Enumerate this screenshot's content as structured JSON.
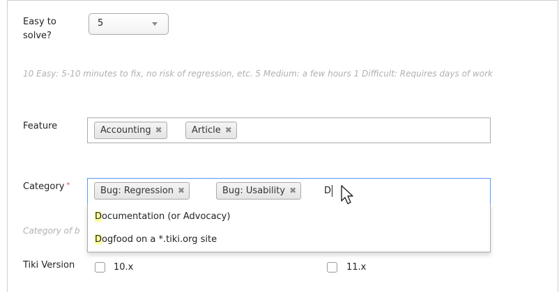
{
  "easy_to_solve": {
    "label": "Easy to solve?",
    "selected_value": "5",
    "help_text": "10 Easy: 5-10 minutes to fix, no risk of regression, etc. 5 Medium: a few hours 1 Difficult: Requires days of work"
  },
  "feature": {
    "label": "Feature",
    "tags": [
      {
        "label": "Accounting"
      },
      {
        "label": "Article"
      }
    ]
  },
  "category": {
    "label": "Category",
    "required_marker": "*",
    "tags": [
      {
        "label": "Bug: Regression"
      },
      {
        "label": "Bug: Usability"
      }
    ],
    "typed_text": "D",
    "help_text_partial": "Category of b",
    "suggestions": [
      {
        "match": "D",
        "rest": "ocumentation (or Advocacy)"
      },
      {
        "match": "D",
        "rest": "ogfood on a *.tiki.org site"
      }
    ]
  },
  "tiki_version": {
    "label": "Tiki Version",
    "options": [
      {
        "label": "10.x",
        "checked": false
      },
      {
        "label": "11.x",
        "checked": false
      }
    ]
  },
  "tag_remove_glyph": "✖",
  "colors": {
    "focus_border": "#5897fb",
    "match_highlight": "#ffffa0",
    "required": "#d9534f"
  }
}
